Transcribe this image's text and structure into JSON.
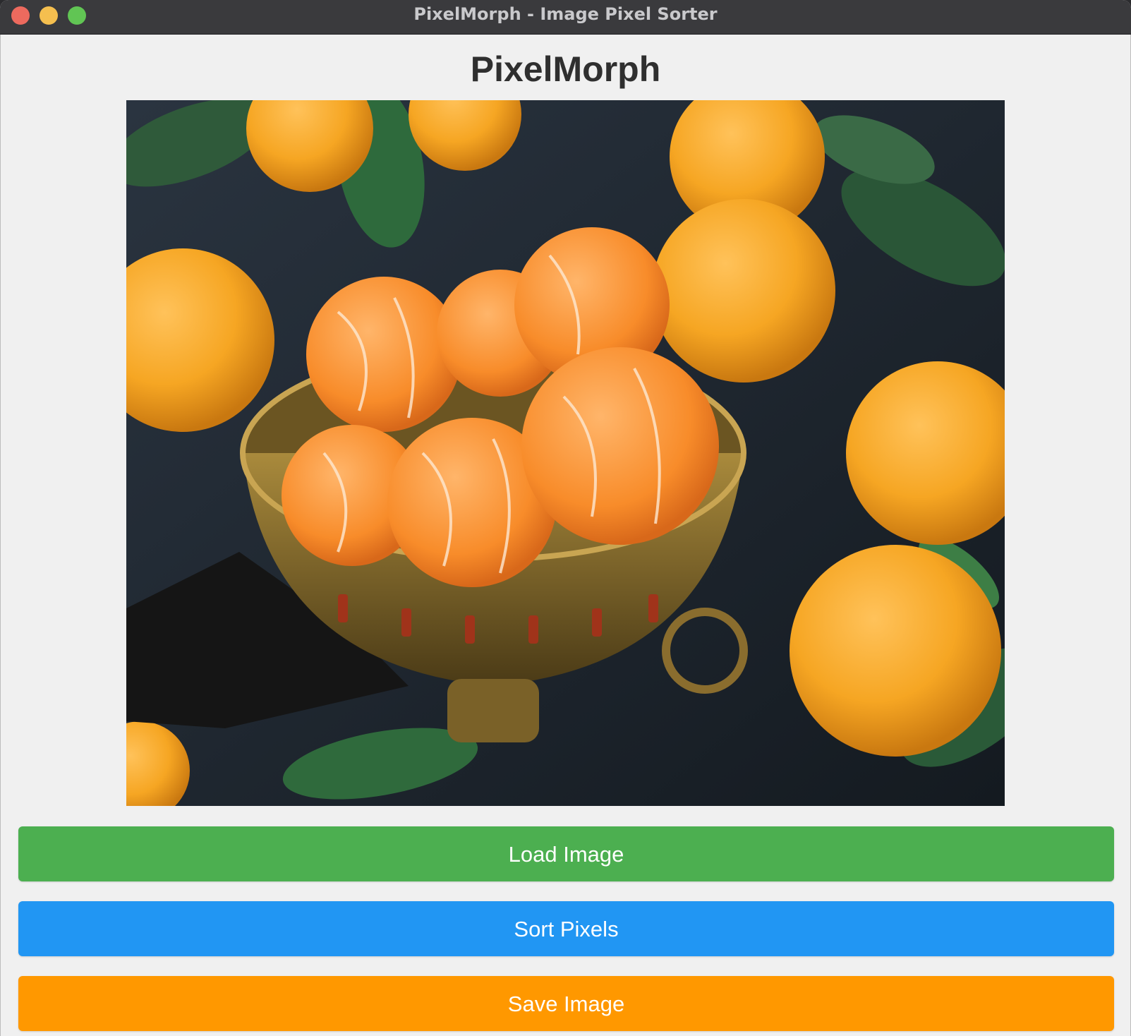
{
  "window": {
    "title": "PixelMorph - Image Pixel Sorter"
  },
  "app": {
    "heading": "PixelMorph"
  },
  "image": {
    "description_icon": "peeled-tangerines-photo"
  },
  "buttons": {
    "load_label": "Load Image",
    "sort_label": "Sort Pixels",
    "save_label": "Save Image"
  },
  "colors": {
    "load": "#4caf50",
    "sort": "#2196f3",
    "save": "#ff9800"
  }
}
